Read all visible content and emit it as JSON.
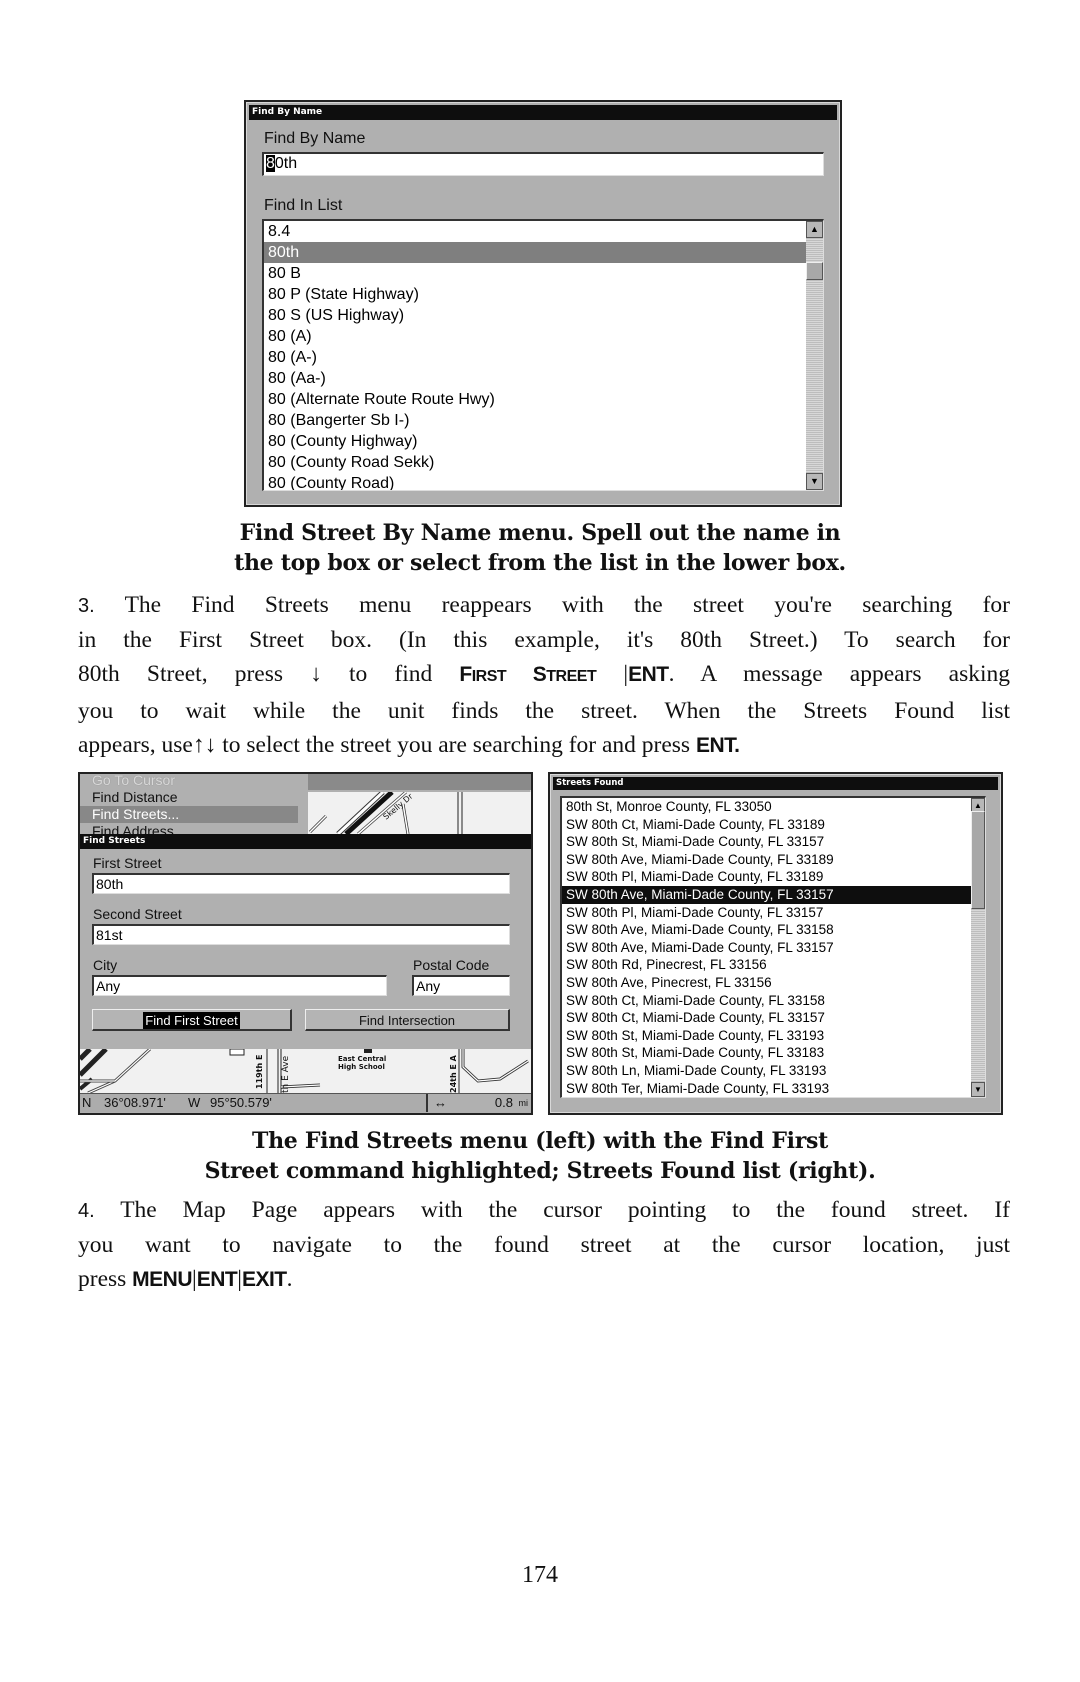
{
  "find_by_name_dialog": {
    "title": "Find By Name",
    "name_label": "Find By Name",
    "name_value_caret": "8",
    "name_value_rest": "0th",
    "list_label": "Find In List",
    "list_items": [
      "8.4",
      "80th",
      "80  B",
      "80  P (State Highway)",
      "80  S (US Highway)",
      "80 (A)",
      "80 (A-)",
      "80 (Aa-)",
      "80 (Alternate Route Route Hwy)",
      "80 (Bangerter Sb I-)",
      "80 (County Highway)",
      "80 (County Road Sekk)",
      "80 (County Road)"
    ],
    "selected_index": 1,
    "scroll_up_icon": "triangle-up",
    "scroll_down_icon": "triangle-down",
    "scroll_position": 0.05
  },
  "caption1": {
    "line1": "Find Street By Name menu. Spell out the name in",
    "line2": "the top box or select from the list in the lower box."
  },
  "step3": {
    "num": "3.",
    "l1": "The Find Streets menu reappears with the street you're searching for",
    "l2": "in the First Street box. (In this example, it's 80th Street.) To search for",
    "l3a": "80th Street, press",
    "down_arrow": "↓",
    "l3b": "to find",
    "key_first_street_F": "F",
    "key_first_street_irst": "IRST",
    "key_first_street_S": "S",
    "key_first_street_treet": "TREET",
    "sep": "|",
    "key_ent": "ENT",
    "l3c": ". A message appears asking",
    "l4": "you to wait while the unit finds the street. When the Streets Found list",
    "l5a": "appears, use",
    "up_down_arrows": "↑↓",
    "l5b": "to select the street you are searching for and press",
    "key_ent2": "ENT."
  },
  "find_streets_screen": {
    "menu_items": [
      "Go To Cursor",
      "Find Distance",
      "Find Streets...",
      "Find Address"
    ],
    "menu_highlighted_index": 2,
    "menu_disabled_index": 0,
    "map_label_top": "Skelly Dr",
    "dialog_title": "Find Streets",
    "first_street_label": "First Street",
    "first_street_value": "80th",
    "second_street_label": "Second Street",
    "second_street_value": "81st",
    "city_label": "City",
    "city_value": "Any",
    "postal_label": "Postal Code",
    "postal_value": "Any",
    "find_first_button": "Find First Street",
    "find_intersection_button": "Find Intersection",
    "map_labels": [
      "119th E",
      "th E Ave",
      "East Central",
      "High School",
      "24th E A"
    ],
    "status_lat_hemi": "N",
    "status_lat": "36°08.971'",
    "status_lon_hemi": "W",
    "status_lon": "95°50.579'",
    "zoom_icon": "left-right-arrow",
    "zoom_value": "0.8",
    "zoom_unit": "mi"
  },
  "streets_found_screen": {
    "title": "Streets Found",
    "items": [
      "80th St, Monroe County, FL 33050",
      "SW 80th Ct, Miami-Dade County, FL 33189",
      "SW 80th St, Miami-Dade County, FL 33157",
      "SW 80th Ave, Miami-Dade County, FL 33189",
      "SW 80th Pl, Miami-Dade County, FL 33189",
      "SW 80th Ave, Miami-Dade County, FL 33157",
      "SW 80th Pl, Miami-Dade County, FL 33157",
      "SW 80th Ave, Miami-Dade County, FL 33158",
      "SW 80th Ave, Miami-Dade County, FL 33157",
      "SW 80th Rd, Pinecrest, FL 33156",
      "SW 80th Ave, Pinecrest, FL 33156",
      "SW 80th Ct, Miami-Dade County, FL 33158",
      "SW 80th Ct, Miami-Dade County, FL 33157",
      "SW 80th St, Miami-Dade County, FL 33193",
      "SW 80th St, Miami-Dade County, FL 33183",
      "SW 80th Ln, Miami-Dade County, FL 33193",
      "SW 80th Ter, Miami-Dade County, FL 33193"
    ],
    "selected_index": 5,
    "scroll_position": 0.0
  },
  "caption2": {
    "line1": "The Find Streets menu (left) with the Find First",
    "line2": "Street command highlighted; Streets Found list (right)."
  },
  "step4": {
    "num": "4.",
    "l1": "The Map Page appears with the cursor pointing to the found street. If",
    "l2": "you want to navigate to the found street at the cursor location, just",
    "l3a": "press",
    "key_menu": "MENU",
    "sep": "|",
    "key_ent": "ENT",
    "key_exit": "EXIT",
    "l3b": "."
  },
  "page_number": "174"
}
